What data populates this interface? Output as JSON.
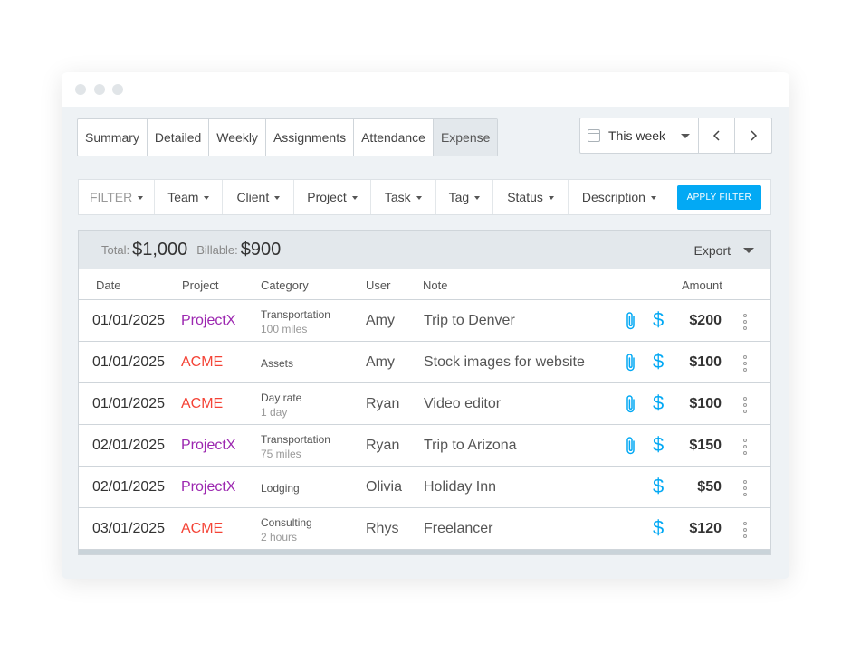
{
  "tabs": [
    {
      "label": "Summary",
      "active": false
    },
    {
      "label": "Detailed",
      "active": false
    },
    {
      "label": "Weekly",
      "active": false
    },
    {
      "label": "Assignments",
      "active": false
    },
    {
      "label": "Attendance",
      "active": false
    },
    {
      "label": "Expense",
      "active": true
    }
  ],
  "date_range": {
    "label": "This week"
  },
  "filters": {
    "filter_label": "FILTER",
    "items": [
      "Team",
      "Client",
      "Project",
      "Task",
      "Tag",
      "Status",
      "Description"
    ],
    "apply_label": "APPLY FILTER"
  },
  "summary": {
    "total_label": "Total:",
    "total_value": "$1,000",
    "billable_label": "Billable:",
    "billable_value": "$900",
    "export_label": "Export"
  },
  "columns": [
    "Date",
    "Project",
    "Category",
    "User",
    "Note",
    "Amount"
  ],
  "rows": [
    {
      "date": "01/01/2025",
      "project": "ProjectX",
      "project_color": "#9c27b0",
      "category": "Transportation",
      "category_sub": "100 miles",
      "user": "Amy",
      "note": "Trip to Denver",
      "attachment": true,
      "billable": true,
      "amount": "$200"
    },
    {
      "date": "01/01/2025",
      "project": "ACME",
      "project_color": "#f44336",
      "category": "Assets",
      "category_sub": "",
      "user": "Amy",
      "note": "Stock images for website",
      "attachment": true,
      "billable": true,
      "amount": "$100"
    },
    {
      "date": "01/01/2025",
      "project": "ACME",
      "project_color": "#f44336",
      "category": "Day rate",
      "category_sub": "1 day",
      "user": "Ryan",
      "note": "Video editor",
      "attachment": true,
      "billable": true,
      "amount": "$100"
    },
    {
      "date": "02/01/2025",
      "project": "ProjectX",
      "project_color": "#9c27b0",
      "category": "Transportation",
      "category_sub": "75 miles",
      "user": "Ryan",
      "note": "Trip to Arizona",
      "attachment": true,
      "billable": true,
      "amount": "$150"
    },
    {
      "date": "02/01/2025",
      "project": "ProjectX",
      "project_color": "#9c27b0",
      "category": "Lodging",
      "category_sub": "",
      "user": "Olivia",
      "note": "Holiday Inn",
      "attachment": false,
      "billable": true,
      "amount": "$50"
    },
    {
      "date": "03/01/2025",
      "project": "ACME",
      "project_color": "#f44336",
      "category": "Consulting",
      "category_sub": "2 hours",
      "user": "Rhys",
      "note": "Freelancer",
      "attachment": false,
      "billable": true,
      "amount": "$120"
    }
  ],
  "icons": {
    "attachment": "paperclip-icon",
    "billable": "dollar-icon",
    "menu": "more-vertical-icon",
    "calendar": "calendar-icon"
  },
  "colors": {
    "accent": "#03a9f4",
    "projectx": "#9c27b0",
    "acme": "#f44336"
  }
}
